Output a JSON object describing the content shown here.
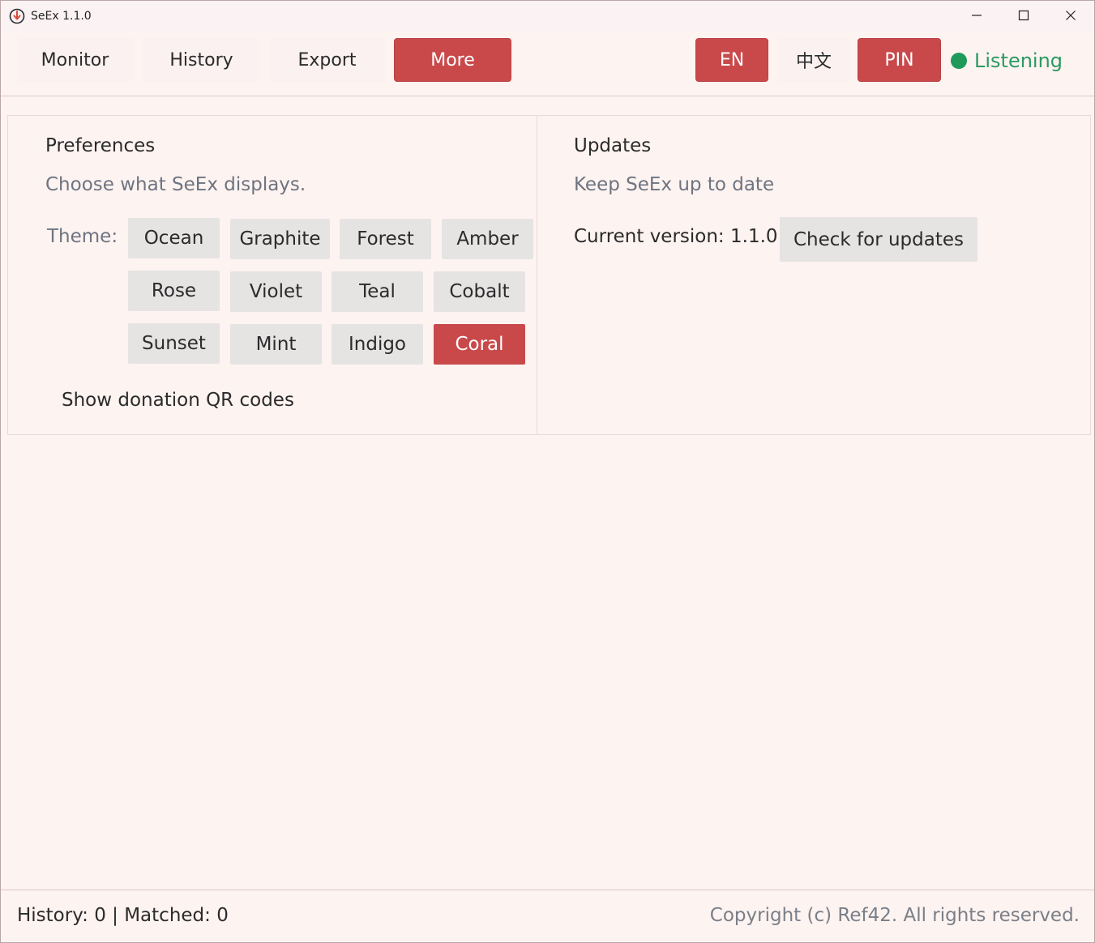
{
  "window": {
    "title": "SeEx 1.1.0",
    "icon": "app-logo-icon",
    "controls": [
      "minimize-icon",
      "maximize-icon",
      "close-icon"
    ]
  },
  "toolbar": {
    "tabs": [
      {
        "label": "Monitor",
        "active": false
      },
      {
        "label": "History",
        "active": false
      },
      {
        "label": "Export",
        "active": false
      },
      {
        "label": "More",
        "active": true
      }
    ],
    "lang_en": "EN",
    "lang_zh": "中文",
    "pin": "PIN",
    "status": {
      "label": "Listening",
      "color": "#1f9a5a"
    }
  },
  "preferences": {
    "heading": "Preferences",
    "subtitle": "Choose what SeEx displays.",
    "theme_label": "Theme:",
    "themes": [
      "Ocean",
      "Graphite",
      "Forest",
      "Amber",
      "Rose",
      "Violet",
      "Teal",
      "Cobalt",
      "Sunset",
      "Mint",
      "Indigo",
      "Coral"
    ],
    "selected_theme": "Coral",
    "donation_toggle": "Show donation QR codes"
  },
  "updates": {
    "heading": "Updates",
    "subtitle": "Keep SeEx up to date",
    "current_version": "Current version: 1.1.0",
    "check_button": "Check for updates"
  },
  "footer": {
    "counts": "History: 0 | Matched: 0",
    "copyright": "Copyright (c) Ref42. All rights reserved."
  },
  "colors": {
    "accent": "#c9494b",
    "background": "#fdf3f1",
    "status_green": "#1f9a5a"
  }
}
